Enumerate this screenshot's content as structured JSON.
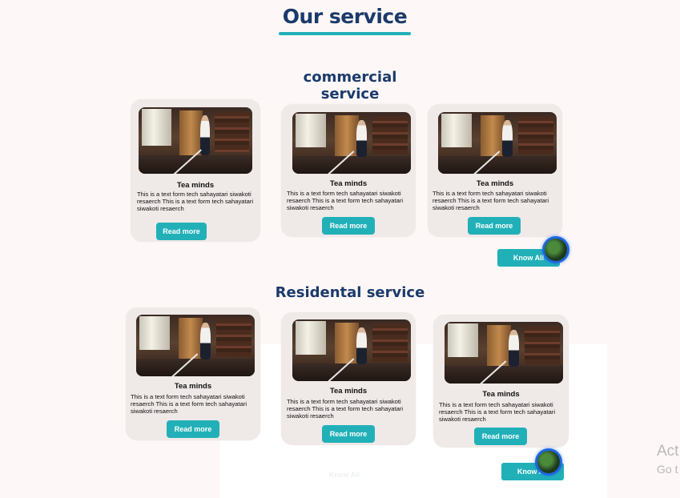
{
  "page_title": "Our service",
  "colors": {
    "accent": "#22b0b8",
    "heading": "#1b3a6b",
    "card": "#efe9e8",
    "background": "#fdf8f7"
  },
  "commercial": {
    "title": "commercial service",
    "cards": [
      {
        "title": "Tea minds",
        "text": "This is a text form tech sahayatari siwakoti resaerch This is a text form tech sahayatari siwakoti resaerch",
        "button": "Read more",
        "image": "cleaning-man-photo"
      },
      {
        "title": "Tea minds",
        "text": "This is a text form tech sahayatari siwakoti resaerch This is a text form tech sahayatari siwakoti resaerch",
        "button": "Read more",
        "image": "cleaning-man-photo"
      },
      {
        "title": "Tea minds",
        "text": "This is a text form tech sahayatari siwakoti resaerch This is a text form tech sahayatari siwakoti resaerch",
        "button": "Read more",
        "image": "cleaning-man-photo"
      }
    ],
    "know_all": "Know All"
  },
  "residential": {
    "title": "Residental service",
    "cards": [
      {
        "title": "Tea minds",
        "text": "This is a text form tech sahayatari siwakoti resaerch This is a text form tech sahayatari siwakoti resaerch",
        "button": "Read more",
        "image": "cleaning-man-photo"
      },
      {
        "title": "Tea minds",
        "text": "This is a text form tech sahayatari siwakoti resaerch This is a text form tech sahayatari siwakoti resaerch",
        "button": "Read more",
        "image": "cleaning-man-photo"
      },
      {
        "title": "Tea minds",
        "text": "This is a text form tech sahayatari siwakoti resaerch This is a text form tech sahayatari siwakoti resaerch",
        "button": "Read more",
        "image": "cleaning-man-photo"
      }
    ],
    "know_all": "Know All"
  },
  "ghost_know_all": "Know All",
  "watermark": {
    "line1": "Act",
    "line2": "Go t"
  }
}
